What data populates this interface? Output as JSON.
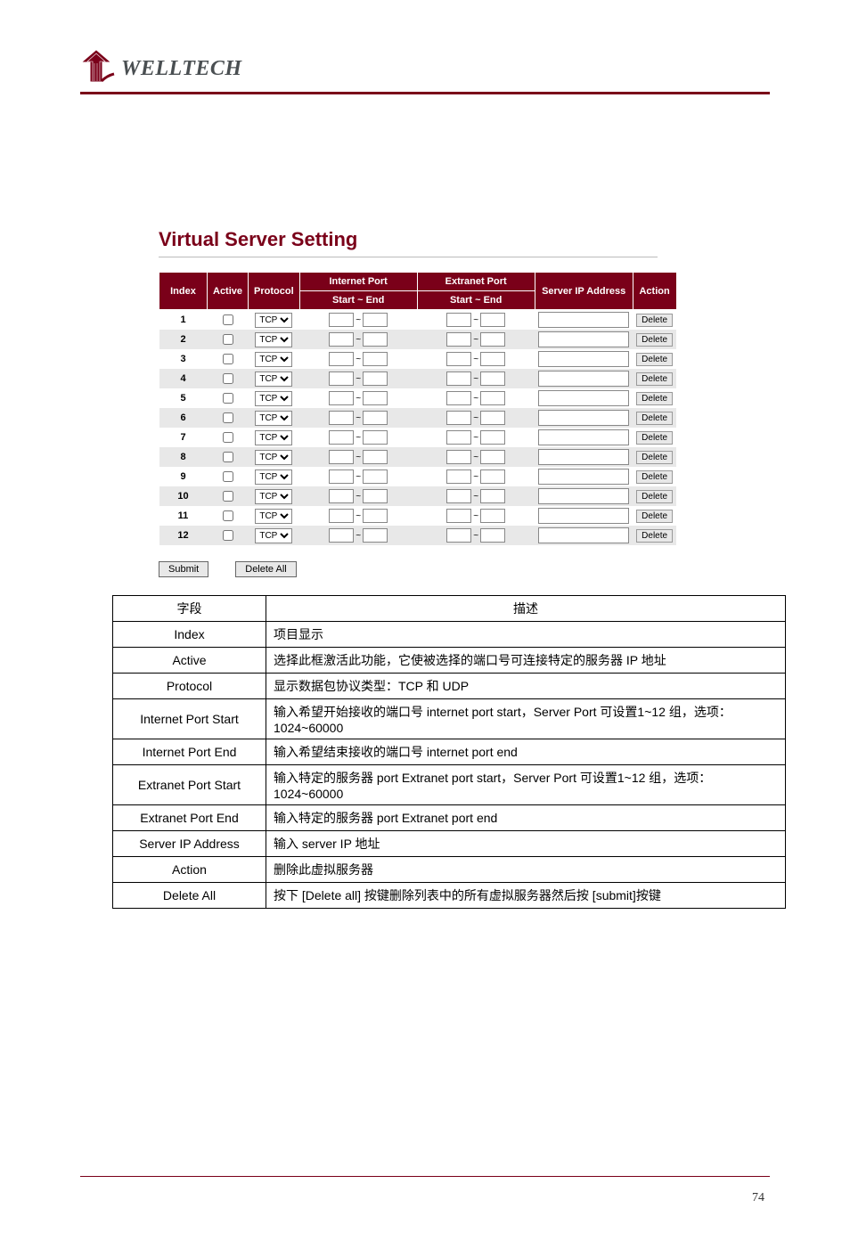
{
  "brand": "WELLTECH",
  "vs": {
    "title": "Virtual Server Setting",
    "headers": {
      "index": "Index",
      "active": "Active",
      "protocol": "Protocol",
      "internet_port": "Internet Port",
      "extranet_port": "Extranet Port",
      "start_end": "Start ~ End",
      "server_ip": "Server IP Address",
      "action": "Action"
    },
    "protocol_options": [
      "TCP"
    ],
    "rows": [
      {
        "index": "1"
      },
      {
        "index": "2"
      },
      {
        "index": "3"
      },
      {
        "index": "4"
      },
      {
        "index": "5"
      },
      {
        "index": "6"
      },
      {
        "index": "7"
      },
      {
        "index": "8"
      },
      {
        "index": "9"
      },
      {
        "index": "10"
      },
      {
        "index": "11"
      },
      {
        "index": "12"
      }
    ],
    "tilde": "~",
    "delete_label": "Delete",
    "submit_label": "Submit",
    "delete_all_label": "Delete All"
  },
  "desc": {
    "headers": {
      "field": "字段",
      "description": "描述"
    },
    "rows": [
      {
        "field": "Index",
        "description": "项目显示"
      },
      {
        "field": "Active",
        "description": "选择此框激活此功能，它使被选择的端口号可连接特定的服务器 IP 地址"
      },
      {
        "field": "Protocol",
        "description": "显示数据包协议类型：TCP 和 UDP"
      },
      {
        "field": "Internet Port Start",
        "description": "输入希望开始接收的端口号 internet port start，Server Port 可设置1~12 组，选项：1024~60000"
      },
      {
        "field": "Internet Port End",
        "description": "输入希望结束接收的端口号 internet port end"
      },
      {
        "field": "Extranet Port Start",
        "description": "输入特定的服务器 port Extranet port start，Server Port 可设置1~12 组，选项：1024~60000"
      },
      {
        "field": "Extranet Port End",
        "description": "输入特定的服务器 port Extranet port end"
      },
      {
        "field": "Server IP Address",
        "description": "输入 server IP 地址"
      },
      {
        "field": "Action",
        "description": "删除此虚拟服务器"
      },
      {
        "field": "Delete All",
        "description": "按下 [Delete all] 按键删除列表中的所有虚拟服务器然后按 [submit]按键"
      }
    ]
  },
  "page_number": "74"
}
